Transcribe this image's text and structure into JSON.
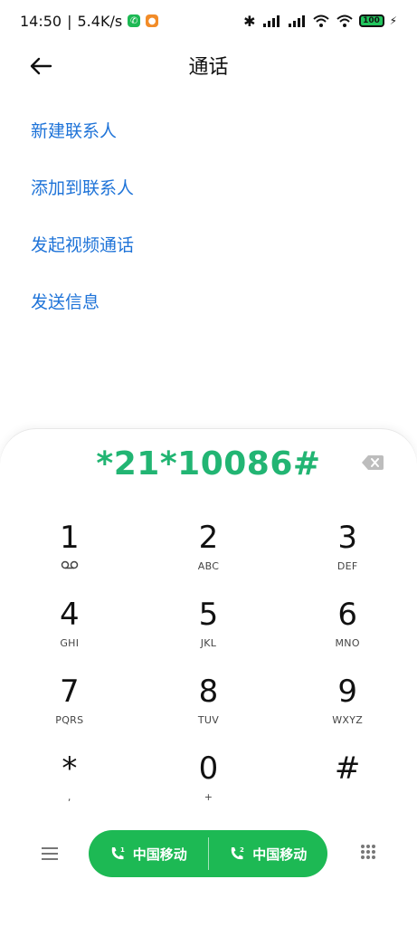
{
  "status": {
    "time": "14:50",
    "speed": "5.4K/s",
    "battery": "100"
  },
  "header": {
    "title": "通话"
  },
  "actions": [
    {
      "label": "新建联系人"
    },
    {
      "label": "添加到联系人"
    },
    {
      "label": "发起视频通话"
    },
    {
      "label": "发送信息"
    }
  ],
  "dialer": {
    "number": "*21*10086#",
    "keys": [
      {
        "main": "1",
        "sub": ""
      },
      {
        "main": "2",
        "sub": "ABC"
      },
      {
        "main": "3",
        "sub": "DEF"
      },
      {
        "main": "4",
        "sub": "GHI"
      },
      {
        "main": "5",
        "sub": "JKL"
      },
      {
        "main": "6",
        "sub": "MNO"
      },
      {
        "main": "7",
        "sub": "PQRS"
      },
      {
        "main": "8",
        "sub": "TUV"
      },
      {
        "main": "9",
        "sub": "WXYZ"
      },
      {
        "main": "*",
        "sub": ","
      },
      {
        "main": "0",
        "sub": "+"
      },
      {
        "main": "#",
        "sub": ""
      }
    ],
    "sim1_label": "中国移动",
    "sim2_label": "中国移动"
  },
  "colors": {
    "accent_blue": "#1e73d8",
    "call_green": "#1db954",
    "number_green": "#22b573"
  },
  "icons": [
    "back-arrow-icon",
    "backspace-icon",
    "voicemail-icon",
    "menu-icon",
    "sim1-phone-icon",
    "sim2-phone-icon",
    "dialpad-grid-icon",
    "bluetooth-icon",
    "signal-icon",
    "wifi-icon",
    "battery-icon"
  ]
}
